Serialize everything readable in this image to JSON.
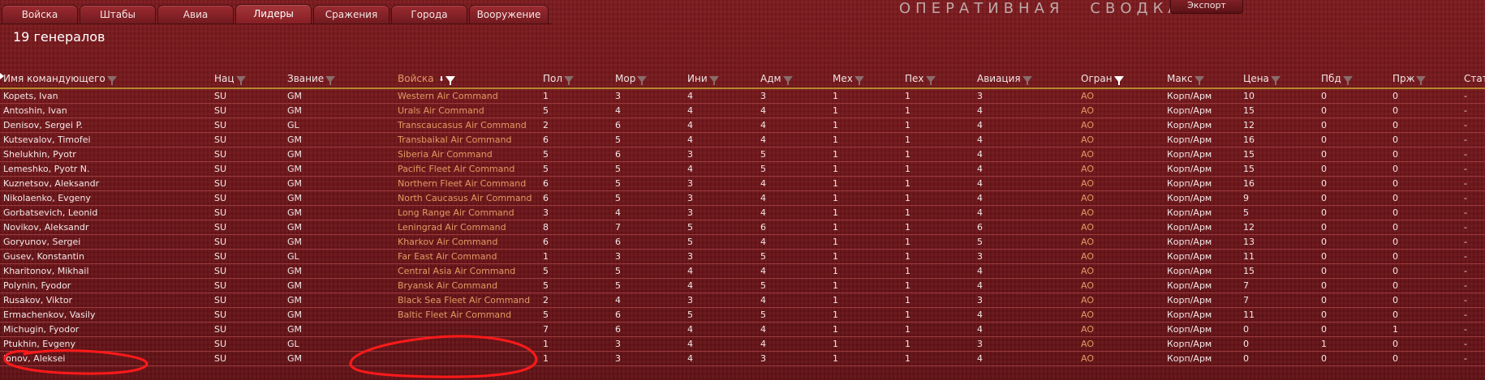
{
  "tabs": [
    "Войска",
    "Штабы",
    "Авиа",
    "Лидеры",
    "Сражения",
    "Города",
    "Вооружение"
  ],
  "active_tab": "Лидеры",
  "header_title_words": [
    "ОПЕРАТИВНАЯ",
    "СВОДКА"
  ],
  "export_label": "Экспорт",
  "count_title": "19 генералов",
  "columns": [
    "Имя командующего",
    "Нац",
    "Звание",
    "Войска",
    "Пол",
    "Мор",
    "Ини",
    "Адм",
    "Мех",
    "Пех",
    "Авиация",
    "Огран",
    "Макс",
    "Цена",
    "Пбд",
    "Прж",
    "Стат"
  ],
  "rows": [
    [
      "Kopets, Ivan",
      "SU",
      "GM",
      "Western Air Command",
      "1",
      "3",
      "4",
      "3",
      "1",
      "1",
      "3",
      "AO",
      "Корп/Арм",
      "10",
      "0",
      "0",
      "-"
    ],
    [
      "Antoshin, Ivan",
      "SU",
      "GM",
      "Urals Air Command",
      "5",
      "4",
      "4",
      "4",
      "1",
      "1",
      "4",
      "AO",
      "Корп/Арм",
      "15",
      "0",
      "0",
      "-"
    ],
    [
      "Denisov, Sergei P.",
      "SU",
      "GL",
      "Transcaucasus Air Command",
      "2",
      "6",
      "4",
      "4",
      "1",
      "1",
      "4",
      "AO",
      "Корп/Арм",
      "12",
      "0",
      "0",
      "-"
    ],
    [
      "Kutsevalov, Timofei",
      "SU",
      "GM",
      "Transbaikal Air Command",
      "6",
      "5",
      "4",
      "4",
      "1",
      "1",
      "4",
      "AO",
      "Корп/Арм",
      "16",
      "0",
      "0",
      "-"
    ],
    [
      "Shelukhin, Pyotr",
      "SU",
      "GM",
      "Siberia Air Command",
      "5",
      "6",
      "3",
      "5",
      "1",
      "1",
      "4",
      "AO",
      "Корп/Арм",
      "15",
      "0",
      "0",
      "-"
    ],
    [
      "Lemeshko, Pyotr N.",
      "SU",
      "GM",
      "Pacific Fleet Air Command",
      "5",
      "5",
      "4",
      "5",
      "1",
      "1",
      "4",
      "AO",
      "Корп/Арм",
      "15",
      "0",
      "0",
      "-"
    ],
    [
      "Kuznetsov, Aleksandr",
      "SU",
      "GM",
      "Northern Fleet Air Command",
      "6",
      "5",
      "3",
      "4",
      "1",
      "1",
      "4",
      "AO",
      "Корп/Арм",
      "16",
      "0",
      "0",
      "-"
    ],
    [
      "Nikolaenko, Evgeny",
      "SU",
      "GM",
      "North Caucasus Air Command",
      "6",
      "5",
      "3",
      "4",
      "1",
      "1",
      "4",
      "AO",
      "Корп/Арм",
      "9",
      "0",
      "0",
      "-"
    ],
    [
      "Gorbatsevich, Leonid",
      "SU",
      "GM",
      "Long Range Air Command",
      "3",
      "4",
      "3",
      "4",
      "1",
      "1",
      "4",
      "AO",
      "Корп/Арм",
      "5",
      "0",
      "0",
      "-"
    ],
    [
      "Novikov, Aleksandr",
      "SU",
      "GM",
      "Leningrad Air Command",
      "8",
      "7",
      "5",
      "6",
      "1",
      "1",
      "6",
      "AO",
      "Корп/Арм",
      "12",
      "0",
      "0",
      "-"
    ],
    [
      "Goryunov, Sergei",
      "SU",
      "GM",
      "Kharkov Air Command",
      "6",
      "6",
      "5",
      "4",
      "1",
      "1",
      "5",
      "AO",
      "Корп/Арм",
      "13",
      "0",
      "0",
      "-"
    ],
    [
      "Gusev, Konstantin",
      "SU",
      "GL",
      "Far East Air Command",
      "1",
      "3",
      "3",
      "5",
      "1",
      "1",
      "3",
      "AO",
      "Корп/Арм",
      "11",
      "0",
      "0",
      "-"
    ],
    [
      "Kharitonov, Mikhail",
      "SU",
      "GM",
      "Central Asia Air Command",
      "5",
      "5",
      "4",
      "4",
      "1",
      "1",
      "4",
      "AO",
      "Корп/Арм",
      "15",
      "0",
      "0",
      "-"
    ],
    [
      "Polynin, Fyodor",
      "SU",
      "GM",
      "Bryansk Air Command",
      "5",
      "5",
      "4",
      "5",
      "1",
      "1",
      "4",
      "AO",
      "Корп/Арм",
      "7",
      "0",
      "0",
      "-"
    ],
    [
      "Rusakov, Viktor",
      "SU",
      "GM",
      "Black Sea Fleet Air Command",
      "2",
      "4",
      "3",
      "4",
      "1",
      "1",
      "3",
      "AO",
      "Корп/Арм",
      "7",
      "0",
      "0",
      "-"
    ],
    [
      "Ermachenkov, Vasily",
      "SU",
      "GM",
      "Baltic Fleet Air Command",
      "5",
      "6",
      "5",
      "5",
      "1",
      "1",
      "4",
      "AO",
      "Корп/Арм",
      "11",
      "0",
      "0",
      "-"
    ],
    [
      "Michugin, Fyodor",
      "SU",
      "GM",
      "",
      "7",
      "6",
      "4",
      "4",
      "1",
      "1",
      "4",
      "AO",
      "Корп/Арм",
      "0",
      "0",
      "1",
      "-"
    ],
    [
      "Ptukhin, Evgeny",
      "SU",
      "GL",
      "",
      "1",
      "3",
      "4",
      "4",
      "1",
      "1",
      "3",
      "AO",
      "Корп/Арм",
      "0",
      "1",
      "0",
      "-"
    ],
    [
      "Ionov, Aleksei",
      "SU",
      "GM",
      "",
      "1",
      "3",
      "4",
      "3",
      "1",
      "1",
      "4",
      "AO",
      "Корп/Арм",
      "0",
      "0",
      "0",
      "-"
    ]
  ],
  "colors": {
    "background": "#6b1418",
    "accent_orange": "#e39a63",
    "header_underline": "#b8862f",
    "annotation_red": "#ff1a1a"
  }
}
